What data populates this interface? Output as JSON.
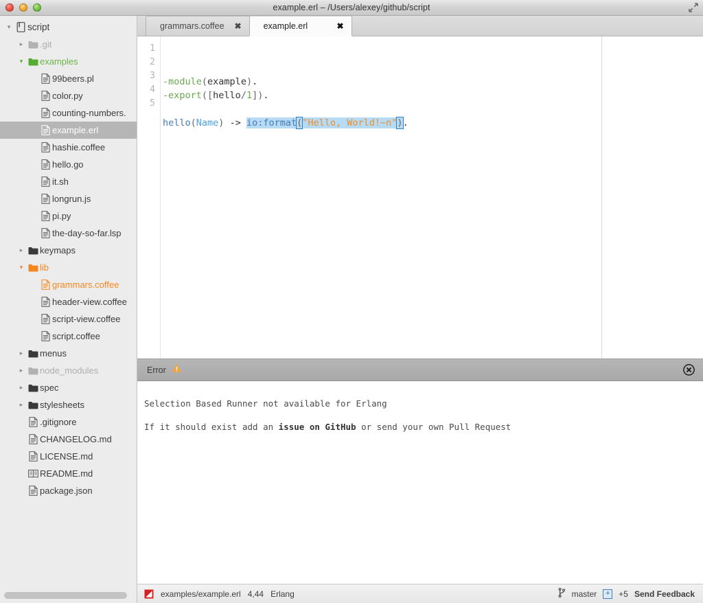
{
  "window": {
    "title": "example.erl – /Users/alexey/github/script",
    "traffic_lights": [
      "close-button",
      "minimize-button",
      "zoom-button"
    ],
    "fullscreen_label": "fullscreen-icon"
  },
  "sidebar": {
    "items": [
      {
        "label": "script",
        "indent": 0,
        "type": "root",
        "twisty": "v",
        "icon": "book-icon",
        "state": "normal"
      },
      {
        "label": ".git",
        "indent": 1,
        "type": "folder",
        "twisty": ">",
        "icon": "folder-icon",
        "state": "dim"
      },
      {
        "label": "examples",
        "indent": 1,
        "type": "folder",
        "twisty": "v",
        "icon": "folder-icon",
        "state": "new"
      },
      {
        "label": "99beers.pl",
        "indent": 2,
        "type": "file",
        "twisty": "",
        "icon": "file-icon",
        "state": "normal"
      },
      {
        "label": "color.py",
        "indent": 2,
        "type": "file",
        "twisty": "",
        "icon": "file-icon",
        "state": "normal"
      },
      {
        "label": "counting-numbers.",
        "indent": 2,
        "type": "file",
        "twisty": "",
        "icon": "file-icon",
        "state": "normal"
      },
      {
        "label": "example.erl",
        "indent": 2,
        "type": "file",
        "twisty": "",
        "icon": "file-icon",
        "state": "selected"
      },
      {
        "label": "hashie.coffee",
        "indent": 2,
        "type": "file",
        "twisty": "",
        "icon": "file-icon",
        "state": "normal"
      },
      {
        "label": "hello.go",
        "indent": 2,
        "type": "file",
        "twisty": "",
        "icon": "file-icon",
        "state": "normal"
      },
      {
        "label": "it.sh",
        "indent": 2,
        "type": "file",
        "twisty": "",
        "icon": "file-icon",
        "state": "normal"
      },
      {
        "label": "longrun.js",
        "indent": 2,
        "type": "file",
        "twisty": "",
        "icon": "file-icon",
        "state": "normal"
      },
      {
        "label": "pi.py",
        "indent": 2,
        "type": "file",
        "twisty": "",
        "icon": "file-icon",
        "state": "normal"
      },
      {
        "label": "the-day-so-far.lsp",
        "indent": 2,
        "type": "file",
        "twisty": "",
        "icon": "file-icon",
        "state": "normal"
      },
      {
        "label": "keymaps",
        "indent": 1,
        "type": "folder",
        "twisty": ">",
        "icon": "folder-icon",
        "state": "normal"
      },
      {
        "label": "lib",
        "indent": 1,
        "type": "folder",
        "twisty": "v",
        "icon": "folder-icon",
        "state": "mod"
      },
      {
        "label": "grammars.coffee",
        "indent": 2,
        "type": "file",
        "twisty": "",
        "icon": "file-icon",
        "state": "mod"
      },
      {
        "label": "header-view.coffee",
        "indent": 2,
        "type": "file",
        "twisty": "",
        "icon": "file-icon",
        "state": "normal"
      },
      {
        "label": "script-view.coffee",
        "indent": 2,
        "type": "file",
        "twisty": "",
        "icon": "file-icon",
        "state": "normal"
      },
      {
        "label": "script.coffee",
        "indent": 2,
        "type": "file",
        "twisty": "",
        "icon": "file-icon",
        "state": "normal"
      },
      {
        "label": "menus",
        "indent": 1,
        "type": "folder",
        "twisty": ">",
        "icon": "folder-icon",
        "state": "normal"
      },
      {
        "label": "node_modules",
        "indent": 1,
        "type": "folder",
        "twisty": ">",
        "icon": "folder-icon",
        "state": "dim"
      },
      {
        "label": "spec",
        "indent": 1,
        "type": "folder",
        "twisty": ">",
        "icon": "folder-icon",
        "state": "normal"
      },
      {
        "label": "stylesheets",
        "indent": 1,
        "type": "folder",
        "twisty": ">",
        "icon": "folder-icon",
        "state": "normal"
      },
      {
        "label": ".gitignore",
        "indent": 1,
        "type": "file",
        "twisty": "",
        "icon": "file-icon",
        "state": "normal"
      },
      {
        "label": "CHANGELOG.md",
        "indent": 1,
        "type": "file",
        "twisty": "",
        "icon": "file-icon",
        "state": "normal"
      },
      {
        "label": "LICENSE.md",
        "indent": 1,
        "type": "file",
        "twisty": "",
        "icon": "file-icon",
        "state": "normal"
      },
      {
        "label": "README.md",
        "indent": 1,
        "type": "file",
        "twisty": "",
        "icon": "readme-icon",
        "state": "normal"
      },
      {
        "label": "package.json",
        "indent": 1,
        "type": "file",
        "twisty": "",
        "icon": "file-icon",
        "state": "normal"
      }
    ]
  },
  "tabs": [
    {
      "label": "grammars.coffee",
      "close": "✖",
      "active": false
    },
    {
      "label": "example.erl",
      "close": "✖",
      "active": true
    }
  ],
  "editor": {
    "line_numbers": [
      "1",
      "2",
      "3",
      "4",
      "5"
    ],
    "lines": [
      [
        {
          "t": "-module",
          "c": "tok-const"
        },
        {
          "t": "(",
          "c": "tok-punc"
        },
        {
          "t": "example",
          "c": "tok-op"
        },
        {
          "t": ")",
          "c": "tok-punc"
        },
        {
          "t": ".",
          "c": "tok-op"
        }
      ],
      [
        {
          "t": "-export",
          "c": "tok-const"
        },
        {
          "t": "([",
          "c": "tok-punc"
        },
        {
          "t": "hello",
          "c": "tok-op"
        },
        {
          "t": "/",
          "c": "tok-punc"
        },
        {
          "t": "1",
          "c": "tok-const"
        },
        {
          "t": "])",
          "c": "tok-punc"
        },
        {
          "t": ".",
          "c": "tok-op"
        }
      ],
      [],
      [
        {
          "t": "hello",
          "c": "tok-kw"
        },
        {
          "t": "(",
          "c": "tok-punc"
        },
        {
          "t": "Name",
          "c": "tok-var"
        },
        {
          "t": ")",
          "c": "tok-punc"
        },
        {
          "t": " -> ",
          "c": "tok-op"
        },
        {
          "t": "io:format",
          "c": "tok-kw sel"
        },
        {
          "t": "(",
          "c": "tok-punc sel cursor-br"
        },
        {
          "t": "\"Hello, World!~n\"",
          "c": "tok-str sel"
        },
        {
          "t": ")",
          "c": "tok-punc sel cursor-br"
        },
        {
          "t": ".",
          "c": "tok-op"
        }
      ],
      []
    ]
  },
  "error_panel": {
    "title": "Error",
    "warning_icon": "warning-triangle-icon",
    "close_icon": "close-circle-icon",
    "messages": [
      {
        "prefix": "Selection Based Runner not available for Erlang",
        "bold": "",
        "suffix": ""
      },
      {
        "prefix": "If it should exist add an ",
        "bold": "issue on GitHub",
        "suffix": " or send your own Pull Request"
      }
    ]
  },
  "statusbar": {
    "run_icon": "script-run-icon",
    "file_path": "examples/example.erl",
    "cursor_position": "4,44",
    "grammar": "Erlang",
    "branch_icon": "git-branch-icon",
    "branch": "master",
    "diff_added_icon": "plus-box-icon",
    "diff_added": "+5",
    "feedback_label": "Send Feedback"
  },
  "colors": {
    "accent_blue": "#4aa3df",
    "selection": "#b7dbf5",
    "modified": "#f5871f",
    "added": "#6ab544",
    "warning": "#f5a33c",
    "run_red": "#d32020",
    "sidebar_bg": "#ececec"
  }
}
